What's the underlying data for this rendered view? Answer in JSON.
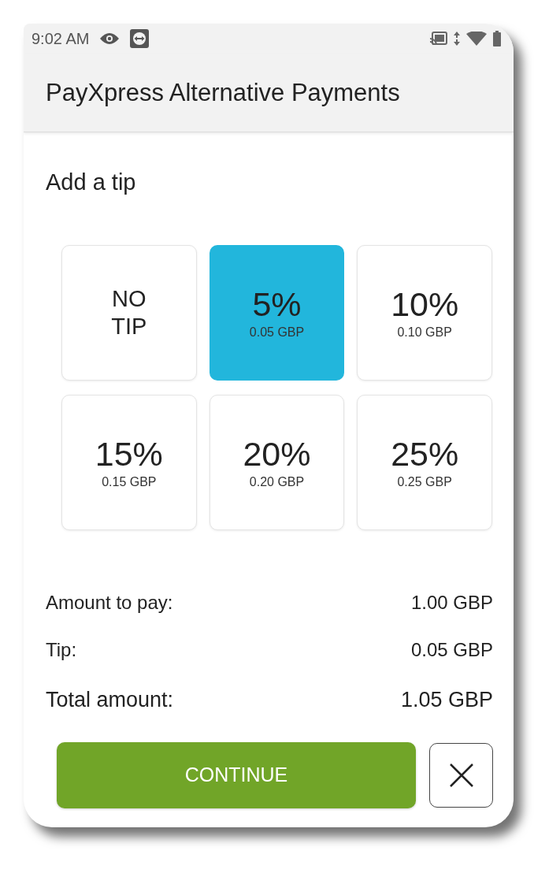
{
  "status_bar": {
    "time": "9:02 AM"
  },
  "app_bar": {
    "title": "PayXpress Alternative Payments"
  },
  "heading": "Add a tip",
  "tip_options": [
    {
      "kind": "none",
      "label": "NO TIP",
      "selected": false
    },
    {
      "kind": "percent",
      "percent": "5%",
      "amount": "0.05 GBP",
      "selected": true
    },
    {
      "kind": "percent",
      "percent": "10%",
      "amount": "0.10 GBP",
      "selected": false
    },
    {
      "kind": "percent",
      "percent": "15%",
      "amount": "0.15 GBP",
      "selected": false
    },
    {
      "kind": "percent",
      "percent": "20%",
      "amount": "0.20 GBP",
      "selected": false
    },
    {
      "kind": "percent",
      "percent": "25%",
      "amount": "0.25 GBP",
      "selected": false
    }
  ],
  "summary": [
    {
      "kind": "line",
      "label": "Amount to pay:",
      "value": "1.00 GBP"
    },
    {
      "kind": "line",
      "label": "Tip:",
      "value": "0.05 GBP"
    },
    {
      "kind": "total",
      "label": "Total amount:",
      "value": "1.05 GBP"
    }
  ],
  "continue_button": {
    "label": "CONTINUE"
  }
}
